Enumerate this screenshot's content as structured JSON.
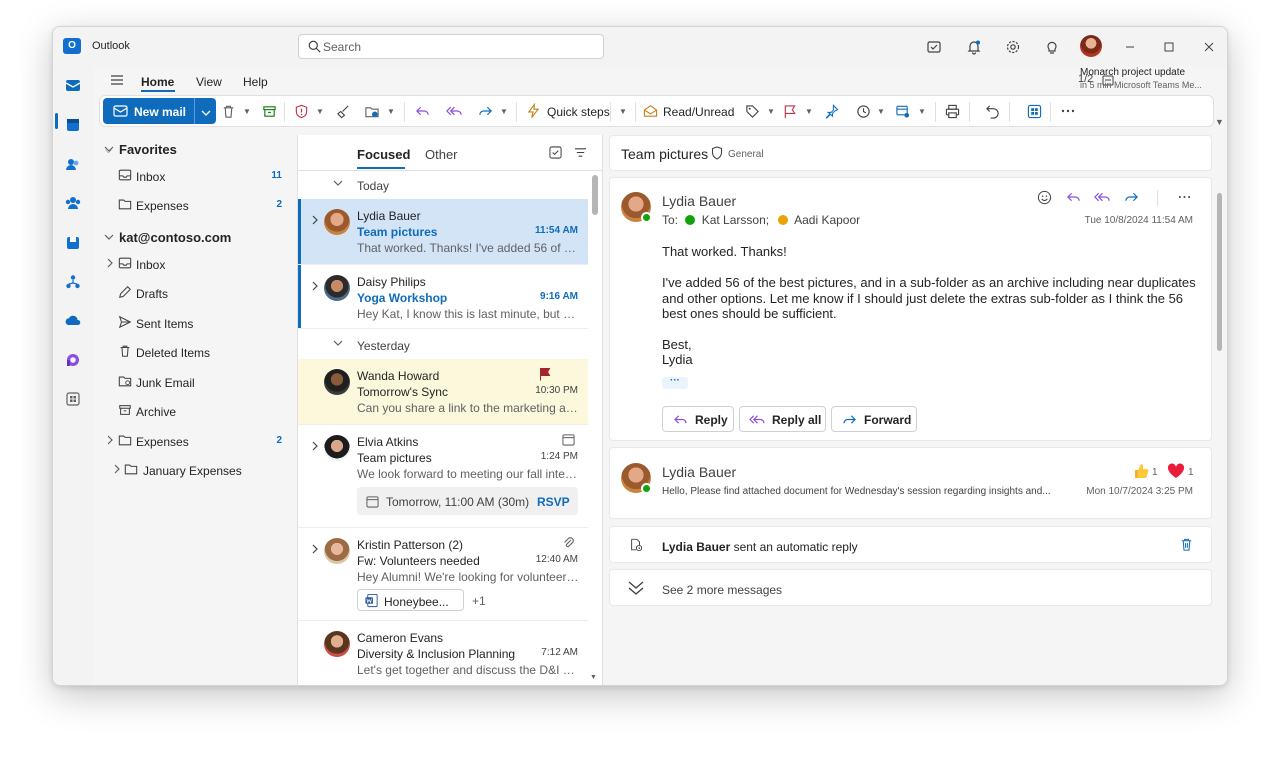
{
  "app": {
    "name": "Outlook",
    "logo": "O"
  },
  "search": {
    "placeholder": "Search"
  },
  "menu": {
    "items": [
      "Home",
      "View",
      "Help"
    ]
  },
  "notification": {
    "counter": "1/2",
    "title": "Monarch project update",
    "subtitle": "in 5 min Microsoft Teams Me..."
  },
  "ribbon": {
    "new_mail": "New mail",
    "quick_steps": "Quick steps",
    "read_unread": "Read/Unread"
  },
  "favorites": {
    "header": "Favorites",
    "items": [
      {
        "label": "Inbox",
        "count": "11"
      },
      {
        "label": "Expenses",
        "count": "2"
      }
    ]
  },
  "account": {
    "header": "kat@contoso.com",
    "folders": [
      {
        "label": "Inbox",
        "count": ""
      },
      {
        "label": "Drafts",
        "count": ""
      },
      {
        "label": "Sent Items",
        "count": ""
      },
      {
        "label": "Deleted Items",
        "count": ""
      },
      {
        "label": "Junk Email",
        "count": ""
      },
      {
        "label": "Archive",
        "count": ""
      },
      {
        "label": "Expenses",
        "count": "2"
      },
      {
        "label": "January Expenses",
        "count": ""
      }
    ]
  },
  "list": {
    "tabs": [
      "Focused",
      "Other"
    ],
    "groups": [
      "Today",
      "Yesterday"
    ],
    "messages": [
      {
        "sender": "Lydia Bauer",
        "subject": "Team pictures",
        "time": "11:54 AM",
        "preview": "That worked. Thanks! I've added 56 of the..."
      },
      {
        "sender": "Daisy Philips",
        "subject": "Yoga Workshop",
        "time": "9:16 AM",
        "preview": "Hey Kat, I know this is last minute, but do..."
      },
      {
        "sender": "Wanda Howard",
        "subject": "Tomorrow's Sync",
        "time": "10:30 PM",
        "preview": "Can you share a link to the marketing asse..."
      },
      {
        "sender": "Elvia Atkins",
        "subject": "Team pictures",
        "time": "1:24 PM",
        "preview": "We look forward to meeting our fall intern...",
        "event": "Tomorrow, 11:00 AM (30m)",
        "rsvp": "RSVP"
      },
      {
        "sender": "Kristin Patterson (2)",
        "subject": "Fw: Volunteers needed",
        "time": "12:40 AM",
        "preview": "Hey Alumni! We're looking for volunteers...",
        "attachment": "Honeybee...",
        "more": "+1"
      },
      {
        "sender": "Cameron Evans",
        "subject": "Diversity & Inclusion Planning",
        "time": "7:12 AM",
        "preview": "Let's get together and discuss the D&I pla..."
      }
    ]
  },
  "reading": {
    "title": "Team pictures",
    "label": "General",
    "message": {
      "sender": "Lydia Bauer",
      "to_label": "To:",
      "recipients": [
        "Kat Larsson;",
        "Aadi Kapoor"
      ],
      "date": "Tue 10/8/2024 11:54 AM",
      "body": [
        "That worked. Thanks!",
        "I've added 56 of the best pictures, and in a sub-folder as an archive including near duplicates and other options. Let me know if I should just delete the extras sub-folder as I think the 56 best ones should be sufficient.",
        "Best,",
        "Lydia"
      ],
      "expand": "···",
      "actions": [
        "Reply",
        "Reply all",
        "Forward"
      ]
    },
    "earlier": {
      "sender": "Lydia Bauer",
      "snippet": "Hello, Please find attached document for Wednesday's session regarding insights and...",
      "date": "Mon 10/7/2024 3:25 PM",
      "reactions": [
        {
          "icon": "thumbs-up-icon",
          "count": "1"
        },
        {
          "icon": "heart-icon",
          "count": "1"
        }
      ]
    },
    "auto_reply": {
      "name": "Lydia Bauer",
      "text": " sent an automatic reply"
    },
    "see_more": "See 2 more messages"
  },
  "colors": {
    "accent": "#0f6cbd",
    "selected": "#d3e4f7",
    "flagged": "#fcf8dc",
    "flag": "#c4314b",
    "presence": "#13a10e"
  }
}
